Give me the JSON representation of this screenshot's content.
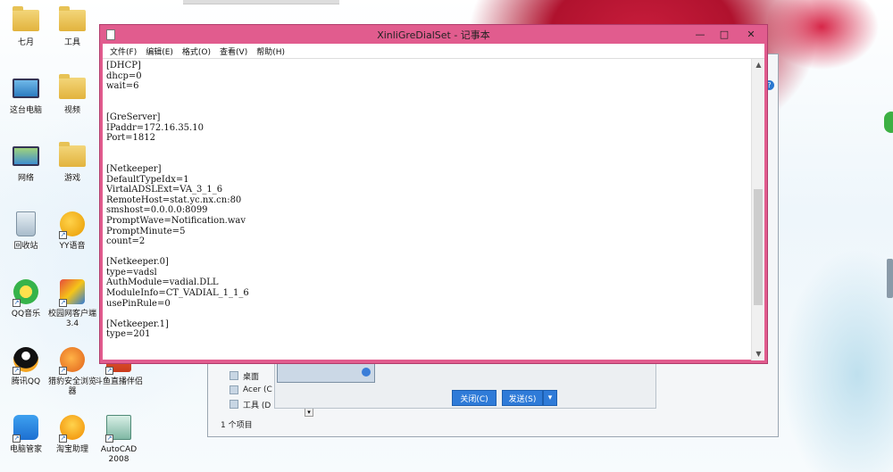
{
  "desktop": {
    "icons": [
      {
        "label": "七月",
        "kind": "folder"
      },
      {
        "label": "工具",
        "kind": "folder"
      },
      {
        "label": "这台电脑",
        "kind": "monitor"
      },
      {
        "label": "视频",
        "kind": "folder"
      },
      {
        "label": "网络",
        "kind": "monitor"
      },
      {
        "label": "游戏",
        "kind": "folder"
      },
      {
        "label": "回收站",
        "kind": "bin"
      },
      {
        "label": "YY语音",
        "kind": "app"
      },
      {
        "label": "QQ音乐",
        "kind": "app"
      },
      {
        "label": "校园网客户端3.4",
        "kind": "app"
      },
      {
        "label": "腾讯QQ",
        "kind": "app"
      },
      {
        "label": "猎豹安全浏览器",
        "kind": "app"
      },
      {
        "label": "斗鱼直播伴侣",
        "kind": "app"
      },
      {
        "label": "电脑管家",
        "kind": "app"
      },
      {
        "label": "淘宝助理",
        "kind": "app"
      },
      {
        "label": "AutoCAD 2008",
        "kind": "app"
      }
    ]
  },
  "background_window": {
    "sidebar": [
      "桌面",
      "Acer (C",
      "工具 (D"
    ],
    "status": "1 个项目",
    "buttons": {
      "close": "关闭(C)",
      "send": "发送(S)",
      "dropdown": "▾"
    }
  },
  "notepad": {
    "title": "XinliGreDialSet - 记事本",
    "controls": {
      "minimize": "—",
      "maximize": "□",
      "close": "✕"
    },
    "menu": [
      "文件(F)",
      "编辑(E)",
      "格式(O)",
      "查看(V)",
      "帮助(H)"
    ],
    "lines": [
      "[DHCP]",
      "dhcp=0",
      "wait=6",
      "",
      "",
      "[GreServer]",
      "IPaddr=172.16.35.10",
      "Port=1812",
      "",
      "",
      "[Netkeeper]",
      "DefaultTypeIdx=1",
      "VirtalADSLExt=VA_3_1_6",
      "RemoteHost=stat.yc.nx.cn:80",
      "smshost=0.0.0.0:8099",
      "PromptWave=Notification.wav",
      "PromptMinute=5",
      "count=2",
      "",
      "[Netkeeper.0]",
      "type=vadsl",
      "AuthModule=vadial.DLL",
      "ModuleInfo=CT_VADIAL_1_1_6",
      "usePinRule=0",
      "",
      "[Netkeeper.1]",
      "type=201"
    ]
  }
}
